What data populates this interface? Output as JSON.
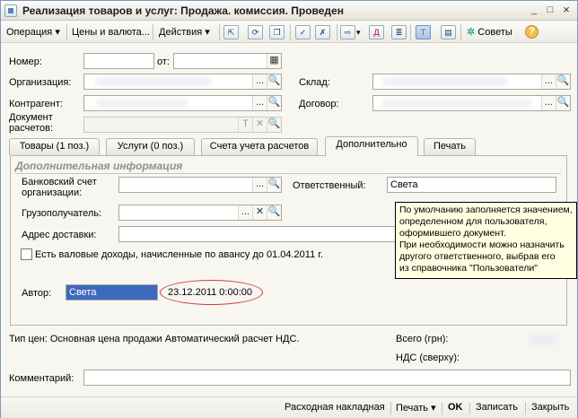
{
  "window": {
    "title": "Реализация товаров и услуг: Продажа. комиссия. Проведен",
    "minimize": "_",
    "maximize": "□",
    "close": "×"
  },
  "toolbar": {
    "operation": "Операция",
    "prices_currency": "Цены и валюта...",
    "actions": "Действия",
    "advice": "Советы",
    "dropdown_arrow": "▾",
    "help": "?"
  },
  "header": {
    "number_label": "Номер:",
    "number_value": "",
    "from_label": "от:",
    "date_value": "",
    "org_label": "Организация:",
    "warehouse_label": "Склад:",
    "contractor_label": "Контрагент:",
    "contract_label": "Договор:",
    "payment_doc_label_1": "Документ",
    "payment_doc_label_2": "расчетов:"
  },
  "tabs": [
    {
      "label": "Товары (1 поз.)"
    },
    {
      "label": "Услуги (0 поз.)"
    },
    {
      "label": "Счета учета расчетов"
    },
    {
      "label": "Дополнительно"
    },
    {
      "label": "Печать"
    }
  ],
  "active_tab": "Дополнительно",
  "additional": {
    "section_title": "Дополнительная информация",
    "bank_account_label_1": "Банковский счет",
    "bank_account_label_2": "организации:",
    "responsible_label": "Ответственный:",
    "responsible_value": "Света",
    "consignee_label": "Грузополучатель:",
    "delivery_address_label": "Адрес доставки:",
    "gross_income_checkbox_label": "Есть валовые доходы, начисленные по авансу до 01.04.2011 г.",
    "author_label": "Автор:",
    "author_value": "Света",
    "date_value": "23.12.2011 0:00:00"
  },
  "tooltip": {
    "lines": [
      "По умолчанию заполняется значением,",
      "определенном  для пользователя,",
      "оформившего документ.",
      "При необходимости можно назначить",
      "другого ответственного, выбрав его",
      "из справочника \"Пользователи\""
    ]
  },
  "footer": {
    "price_type_text": "Тип цен: Основная цена продажи Автоматический расчет НДС.",
    "total_label": "Всего (грн):",
    "vat_label": "НДС (сверху):",
    "comment_label": "Комментарий:",
    "comment_value": ""
  },
  "bottom_bar": {
    "invoice": "Расходная накладная",
    "print": "Печать",
    "ok": "OK",
    "save": "Записать",
    "close": "Закрыть"
  },
  "field_buttons": {
    "select": "...",
    "clear": "✕",
    "search": "🔍",
    "text": "T",
    "calendar": "▦"
  },
  "colors": {
    "selection_blue": "#3c69be",
    "tooltip_bg": "#ffffe1",
    "annotation_red": "#d13a3a"
  }
}
